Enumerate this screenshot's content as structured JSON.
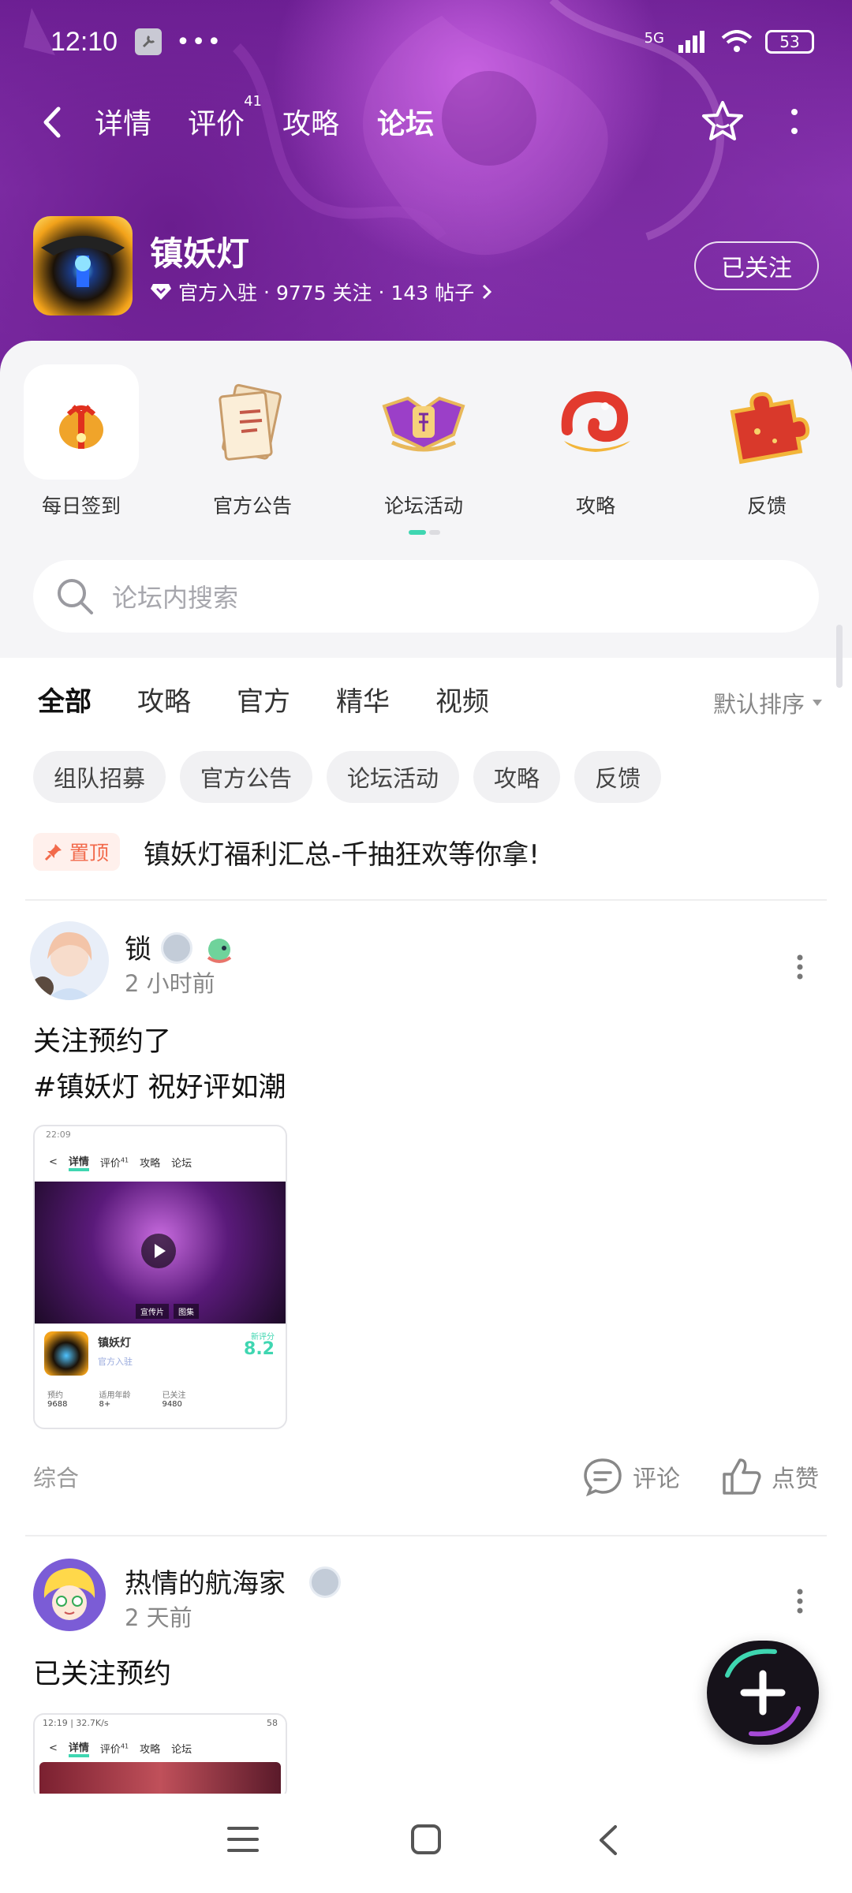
{
  "status_bar": {
    "time": "12:10",
    "signal": "5G",
    "battery": "53"
  },
  "nav": {
    "tabs": [
      {
        "label": "详情"
      },
      {
        "label": "评价",
        "badge": "41"
      },
      {
        "label": "攻略"
      },
      {
        "label": "论坛"
      }
    ],
    "active_tab": "论坛"
  },
  "game": {
    "name": "镇妖灯",
    "official": "官方入驻",
    "followers": "9775 关注",
    "posts": "143 帖子",
    "sep": "·",
    "follow_label": "已关注"
  },
  "quick_entries": [
    {
      "label": "每日签到",
      "icon": "lucky-bag-icon"
    },
    {
      "label": "官方公告",
      "icon": "scroll-icon"
    },
    {
      "label": "论坛活动",
      "icon": "crest-icon"
    },
    {
      "label": "攻略",
      "icon": "dragon-icon"
    },
    {
      "label": "反馈",
      "icon": "puzzle-icon"
    }
  ],
  "search": {
    "placeholder": "论坛内搜索"
  },
  "categories": [
    "全部",
    "攻略",
    "官方",
    "精华",
    "视频"
  ],
  "sort_label": "默认排序",
  "chips": [
    "组队招募",
    "官方公告",
    "论坛活动",
    "攻略",
    "反馈"
  ],
  "pinned": {
    "badge": "置顶",
    "title": "镇妖灯福利汇总-千抽狂欢等你拿!"
  },
  "posts": [
    {
      "user": "锁",
      "time": "2 小时前",
      "lines": [
        "关注预约了",
        "#镇妖灯 祝好评如潮"
      ],
      "thumb": {
        "time": "22:09",
        "tabs": [
          "详情",
          "评价",
          "攻略",
          "论坛"
        ],
        "tab_badge": "41",
        "game": "镇妖灯",
        "official": "官方入驻",
        "score_label": "新评分",
        "score": "8.2",
        "stats": [
          {
            "k": "预约",
            "v": "9688"
          },
          {
            "k": "适用年龄",
            "v": "8+"
          },
          {
            "k": "已关注",
            "v": "9480"
          }
        ],
        "overlay": [
          "宣传片",
          "图集"
        ]
      },
      "tag": "综合",
      "comment_label": "评论",
      "like_label": "点赞"
    },
    {
      "user": "热情的航海家",
      "time": "2 天前",
      "lines": [
        "已关注预约"
      ],
      "thumb": {
        "status": "12:19 | 32.7K/s",
        "battery": "58",
        "tabs": [
          "详情",
          "评价",
          "攻略",
          "论坛"
        ],
        "tab_badge": "41"
      }
    }
  ],
  "colors": {
    "accent": "#3fd6b1",
    "header": "#7b2aa3",
    "pin": "#f26a4b"
  }
}
